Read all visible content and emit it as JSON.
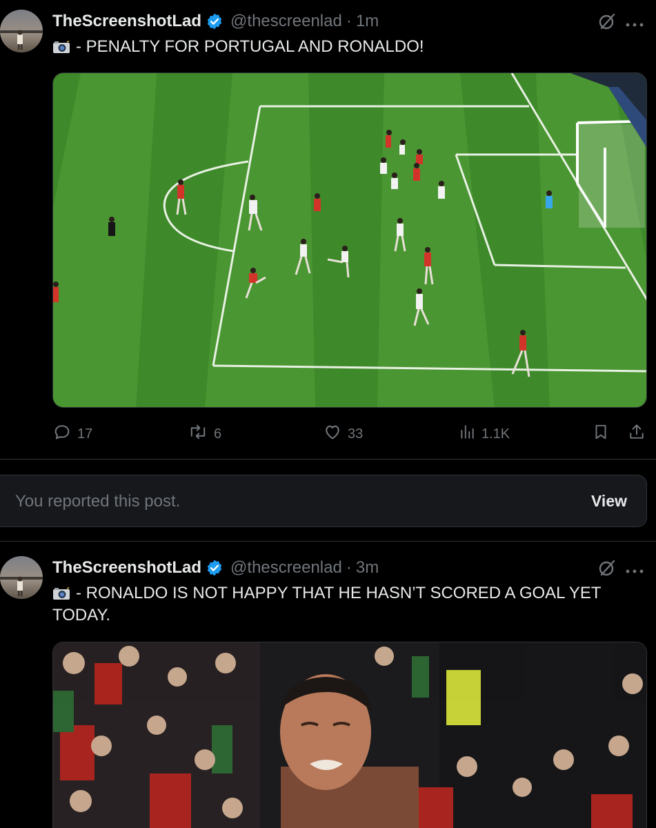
{
  "posts": [
    {
      "author_name": "TheScreenshotLad",
      "handle": "@thescreenlad",
      "separator": "·",
      "time": "1m",
      "text": "- PENALTY FOR PORTUGAL AND RONALDO!",
      "media_alt": "Football match - penalty area",
      "replies": "17",
      "reposts": "6",
      "likes": "33",
      "views": "1.1K"
    },
    {
      "author_name": "TheScreenshotLad",
      "handle": "@thescreenlad",
      "separator": "·",
      "time": "3m",
      "text": "- RONALDO IS NOT HAPPY THAT HE HASN’T SCORED A GOAL YET TODAY.",
      "media_alt": "Ronaldo reacting in front of crowd"
    }
  ],
  "report_notice": {
    "text": "You reported this post.",
    "view_label": "View"
  },
  "colors": {
    "background": "#000000",
    "text_primary": "#e7e9ea",
    "text_secondary": "#71767b",
    "verified_blue": "#1d9bf0",
    "border": "#2f3336",
    "pitch_green": "#3f8a2a"
  },
  "icons": [
    "verified-badge-icon",
    "grok-icon",
    "more-icon",
    "camera-flash-emoji",
    "reply-icon",
    "repost-icon",
    "like-icon",
    "views-icon",
    "bookmark-icon",
    "share-icon"
  ]
}
